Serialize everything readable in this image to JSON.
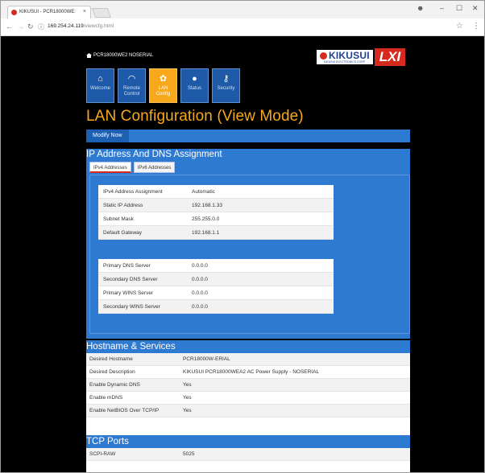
{
  "browser": {
    "tab_title": "KIKUSUI - PCR18000WE:",
    "tab_close": "×",
    "url_host": "169.254.24.119",
    "url_path": "/viewcfg.html",
    "win_min": "–",
    "win_max": "☐",
    "win_close": "✕",
    "profile_icon": "☻"
  },
  "brand": {
    "device_name": "PCR18000WE2 NOSERIAL",
    "kikusui_logo": "KIKUSUI",
    "kikusui_sub": "KIKUSUI ELECTRONICS CORP.",
    "lxi_logo": "LXI"
  },
  "nav": {
    "tiles": [
      {
        "icon": "home-icon",
        "glyph": "⌂",
        "label1": "Welcome",
        "label2": ""
      },
      {
        "icon": "remote-gauge-icon",
        "glyph": "◠",
        "label1": "Remote",
        "label2": "Control"
      },
      {
        "icon": "gear-icon",
        "glyph": "✿",
        "label1": "LAN",
        "label2": "Config"
      },
      {
        "icon": "info-icon",
        "glyph": "●",
        "label1": "Status",
        "label2": ""
      },
      {
        "icon": "key-icon",
        "glyph": "⚷",
        "label1": "Security",
        "label2": ""
      }
    ]
  },
  "page_title": "LAN Configuration (View Mode)",
  "modify_button": "Modify Now",
  "ip_section": {
    "title": "IP Address And DNS Assignment",
    "tabs": [
      "IPv4 Addresses",
      "IPv6 Addresses"
    ],
    "table1": [
      {
        "k": "IPv4 Address Assignment",
        "v": "Automatic"
      },
      {
        "k": "Static IP Address",
        "v": "192.168.1.33"
      },
      {
        "k": "Subnet Mask",
        "v": "255.255.0.0"
      },
      {
        "k": "Default Gateway",
        "v": "192.168.1.1"
      }
    ],
    "table2": [
      {
        "k": "Primary DNS Server",
        "v": "0.0.0.0"
      },
      {
        "k": "Secondary DNS Server",
        "v": "0.0.0.0"
      },
      {
        "k": "Primary WINS Server",
        "v": "0.0.0.0"
      },
      {
        "k": "Secondary WINS Server",
        "v": "0.0.0.0"
      }
    ]
  },
  "hostname_section": {
    "title": "Hostname & Services",
    "rows": [
      {
        "k": "Desired Hostname",
        "v": "PCR18000W-ERIAL"
      },
      {
        "k": "Desired Description",
        "v": "KIKUSUI PCR18000WEA2 AC Power Supply - NOSERIAL"
      },
      {
        "k": "Enable Dynamic DNS",
        "v": "Yes"
      },
      {
        "k": "Enable mDNS",
        "v": "Yes"
      },
      {
        "k": "Enable NetBIOS Over TCP/IP",
        "v": "Yes"
      }
    ]
  },
  "tcp_section": {
    "title": "TCP Ports",
    "rows": [
      {
        "k": "SCPI-RAW",
        "v": "5025"
      }
    ]
  },
  "colors": {
    "accent_orange": "#f7a81b",
    "panel_blue": "#2e7ad1",
    "tile_blue": "#1e5aa8",
    "kikusui_red": "#d52b1e"
  }
}
